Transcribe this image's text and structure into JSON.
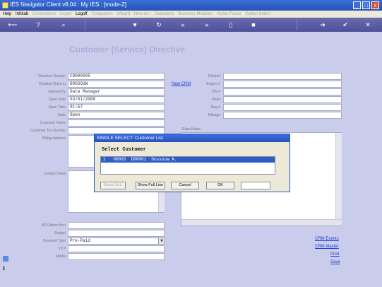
{
  "window": {
    "title": "IES Navigator Client v8.04 : My IES :    [mode-Z]",
    "minimize": "_",
    "maximize": "□",
    "close": "x"
  },
  "menu": {
    "items": [
      {
        "label": "Help",
        "enabled": true
      },
      {
        "label": "Infolab",
        "enabled": true
      },
      {
        "label": "Connections",
        "enabled": false
      },
      {
        "label": "Logon",
        "enabled": false
      },
      {
        "label": "Logoff",
        "enabled": true
      },
      {
        "label": "Companies",
        "enabled": false
      },
      {
        "label": "Wizard",
        "enabled": false
      },
      {
        "label": "How do I",
        "enabled": false
      },
      {
        "label": "DataMarts",
        "enabled": false
      },
      {
        "label": "Business Modules",
        "enabled": false
      },
      {
        "label": "Action Focus",
        "enabled": false
      },
      {
        "label": "Option Select",
        "enabled": false
      }
    ]
  },
  "toolbar": {
    "icons": [
      "back-arrow-icon",
      "help-icon",
      "search-icon",
      "heart-icon",
      "refresh-icon",
      "rewind-icon",
      "fast-forward-icon",
      "folder-icon",
      "stop-icon",
      "right-arrow-icon",
      "check-icon",
      "close-icon"
    ]
  },
  "form": {
    "heading": "Customer (Service) Directive",
    "left_fields": [
      {
        "label": "Directive Number",
        "value": "CD000005"
      },
      {
        "label": "Relative Client to",
        "value": "D0SSOUW"
      },
      {
        "label": "Opened By",
        "value": "Data Manager"
      },
      {
        "label": "Open Date",
        "value": "03/01/2008"
      },
      {
        "label": "Open Time",
        "value": "   01:57"
      },
      {
        "label": "State",
        "value": "Open"
      },
      {
        "label": "Customer Name",
        "value": ""
      },
      {
        "label": "Customer Tax Number",
        "value": ""
      },
      {
        "label": "Billing Address",
        "value": ""
      }
    ],
    "right_fields": [
      {
        "label": "Deleted",
        "value": ""
      },
      {
        "label": "Engine #",
        "value": ""
      },
      {
        "label": "VIN #",
        "value": ""
      },
      {
        "label": "Make",
        "value": ""
      },
      {
        "label": "Reg #",
        "value": ""
      },
      {
        "label": "Mileage",
        "value": ""
      }
    ],
    "new_crm": "New CRM",
    "extra_notes_label": "Extra Notes",
    "contact_detail_label": "Contact Detail",
    "bottom_fields": [
      {
        "label": "AR Debtor Acct",
        "value": ""
      },
      {
        "label": "Budget",
        "value": ""
      },
      {
        "label": "Payment Type",
        "value": "Pre-Paid"
      },
      {
        "label": "Of #",
        "value": ""
      },
      {
        "label": "Media",
        "value": ""
      }
    ],
    "links": [
      "CRM Events",
      "CRM Master",
      "Print",
      "Save"
    ]
  },
  "dialog": {
    "title": "SINGLE SELECT: Customer List",
    "heading": "Select Customer",
    "rows": [
      "1   00003  D00001  Dossouw A."
    ],
    "buttons": {
      "select_all": "Select ALL",
      "show_full_line": "Show Full Line",
      "cancel": "Cancel",
      "ok": "OK"
    }
  }
}
